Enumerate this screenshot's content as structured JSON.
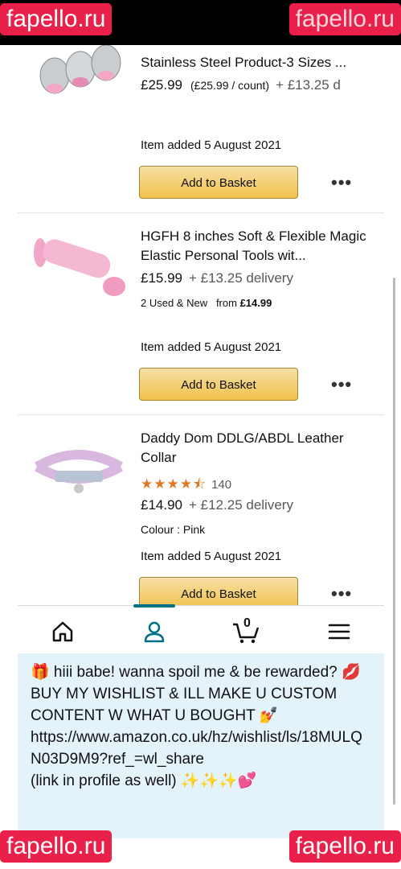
{
  "watermark": "fapello.ru",
  "items": [
    {
      "title": "Stainless Steel Product-3 Sizes ...",
      "price": "£25.99",
      "unit_price": "(£25.99 / count)",
      "delivery": "+ £13.25 d",
      "added": "Item added 5 August 2021",
      "button": "Add to Basket"
    },
    {
      "title": "HGFH 8 inches Soft & Flexible Magic Elastic Personal Tools wit...",
      "price": "£15.99",
      "delivery": "+ £13.25 delivery",
      "used_new": "2 Used & New",
      "used_from_label": "from",
      "used_from_price": "£14.99",
      "added": "Item added 5 August 2021",
      "button": "Add to Basket"
    },
    {
      "title": "Daddy Dom DDLG/ABDL Leather Collar",
      "rating": 4.5,
      "stars_glyph": "★★★★⯪",
      "rating_count": "140",
      "price": "£14.90",
      "delivery": "+ £12.25 delivery",
      "colour": "Colour : Pink",
      "added": "Item added 5 August 2021",
      "button": "Add to Basket"
    }
  ],
  "more_glyph": "•••",
  "nav": {
    "icons": [
      "home-icon",
      "account-icon",
      "cart-icon",
      "menu-icon"
    ],
    "cart_count": "0",
    "accent": "#007185"
  },
  "caption": {
    "line1": "🎁 hiii babe! wanna spoil me & be rewarded? 💋 BUY MY WISHLIST & ILL MAKE U CUSTOM CONTENT W WHAT U BOUGHT 💅",
    "url": "https://www.amazon.co.uk/hz/wishlist/ls/18MULQN03D9M9?ref_=wl_share",
    "link_note": "(link in profile as well) ✨✨✨💕"
  },
  "colors": {
    "button_top": "#f7dfa5",
    "button_bottom": "#f0c14b",
    "star": "#de7921",
    "caption_bg": "#e4f2fa",
    "watermark_bg": "#e8204a"
  }
}
